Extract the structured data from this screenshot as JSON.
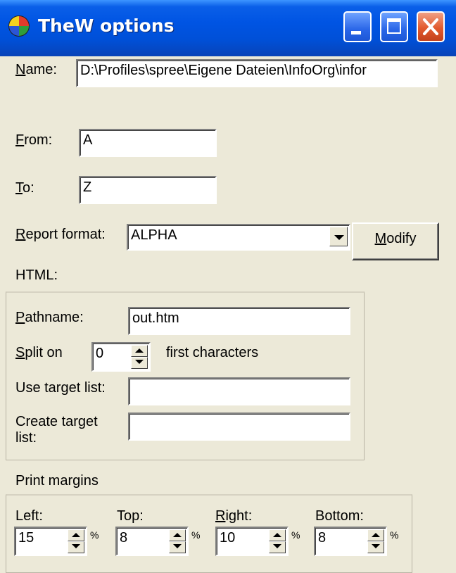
{
  "window": {
    "title": "TheW options",
    "icon": "color-wheel-icon"
  },
  "name": {
    "label_u": "N",
    "label_rest": "ame:",
    "value": "D:\\Profiles\\spree\\Eigene Dateien\\InfoOrg\\infor"
  },
  "from": {
    "label_u": "F",
    "label_rest": "rom:",
    "value": "A"
  },
  "to": {
    "label_u": "T",
    "label_rest": "o:",
    "value": "Z"
  },
  "report_format": {
    "label_u": "R",
    "label_rest": "eport format:",
    "value": "ALPHA",
    "modify_u": "M",
    "modify_rest": "odify"
  },
  "html": {
    "section_label": "HTML:",
    "pathname": {
      "label_u": "P",
      "label_rest": "athname:",
      "value": "out.htm"
    },
    "split": {
      "label_u": "S",
      "label_rest": "plit on",
      "value": "0",
      "suffix": "first characters"
    },
    "use_target": {
      "label": "Use target list:",
      "value": ""
    },
    "create_target": {
      "label_line1": "Create target",
      "label_line2": "list:",
      "value": ""
    }
  },
  "margins": {
    "section_label": "Print margins",
    "left": {
      "label": "Left:",
      "value": "15"
    },
    "top": {
      "label": "Top:",
      "value": "8"
    },
    "right": {
      "label_u": "R",
      "label_rest": "ight:",
      "value": "10"
    },
    "bottom": {
      "label": "Bottom:",
      "value": "8"
    },
    "unit": "%"
  }
}
